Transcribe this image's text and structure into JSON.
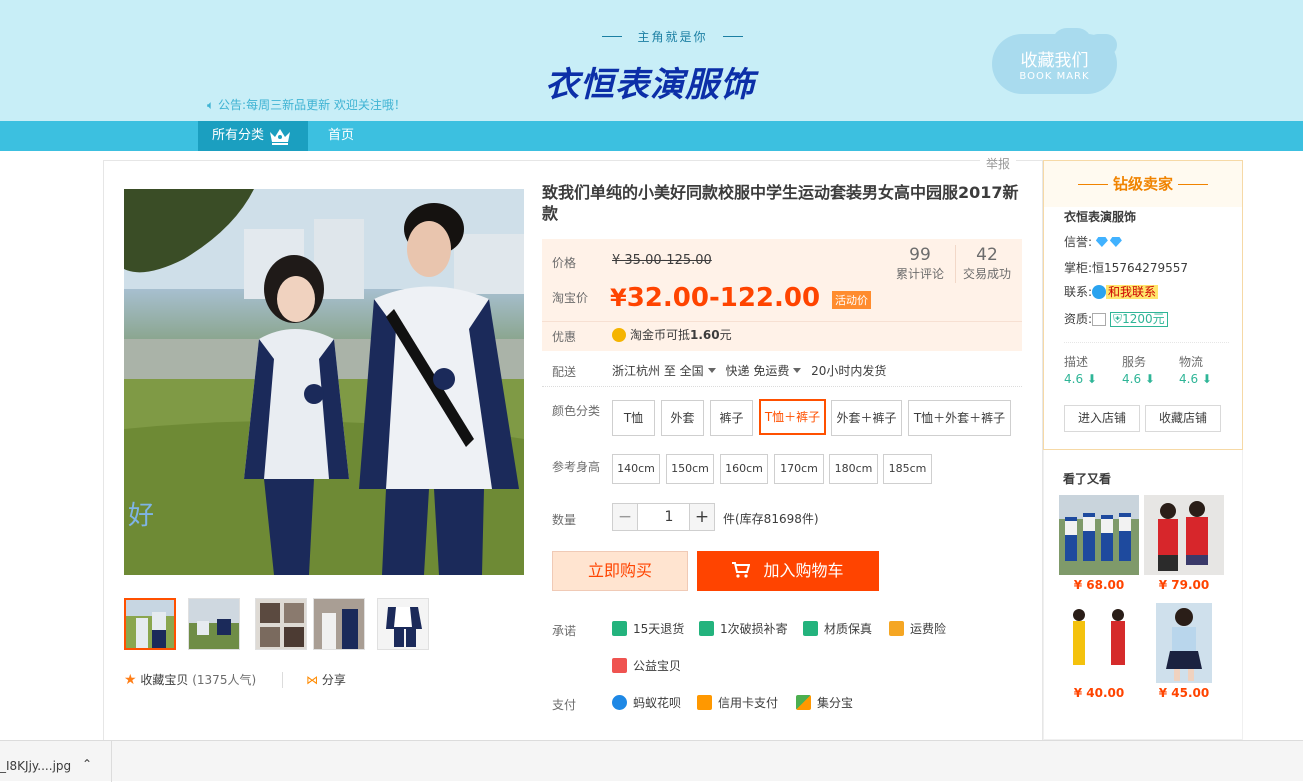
{
  "banner": {
    "tagline": "主角就是你",
    "shop_name": "衣恒表演服饰",
    "notice": "公告:每周三新品更新 欢迎关注哦！",
    "bookmark_cn": "收藏我们",
    "bookmark_en": "BOOK MARK"
  },
  "nav": {
    "all_categories": "所有分类",
    "home": "首页"
  },
  "report": "举报",
  "product": {
    "title": "致我们单纯的小美好同款校服中学生运动套装男女高中园服2017新款",
    "price_label": "价格",
    "original_price": "¥ 35.00-125.00",
    "taobao_price_label": "淘宝价",
    "currency": "¥",
    "taobao_price": "32.00-122.00",
    "promo_badge": "活动价",
    "reviews_count": "99",
    "reviews_label": "累计评论",
    "sales_count": "42",
    "sales_label": "交易成功",
    "discount_label": "优惠",
    "discount_text_prefix": "淘金币可抵",
    "discount_amount": "1.60",
    "discount_text_suffix": "元",
    "shipping_label": "配送",
    "ship_from": "浙江杭州 至",
    "ship_to": "全国",
    "ship_method": "快递 免运费",
    "ship_time": "20小时内发货",
    "color_label": "颜色分类",
    "colors": [
      "T恤",
      "外套",
      "裤子",
      "T恤＋裤子",
      "外套＋裤子",
      "T恤＋外套＋裤子"
    ],
    "selected_color": "T恤＋裤子",
    "size_label": "参考身高",
    "sizes": [
      "140cm",
      "150cm",
      "160cm",
      "170cm",
      "180cm",
      "185cm"
    ],
    "qty_label": "数量",
    "qty_minus": "−",
    "qty_value": "1",
    "qty_plus": "+",
    "stock_text": "件(库存81698件)",
    "buy_now": "立即购买",
    "add_to_cart": "加入购物车",
    "promise_label": "承诺",
    "promises": [
      "15天退货",
      "1次破损补寄",
      "材质保真",
      "运费险",
      "公益宝贝"
    ],
    "pay_label": "支付",
    "payments": [
      "蚂蚁花呗",
      "信用卡支付",
      "集分宝"
    ],
    "favorite_text": "收藏宝贝",
    "favorite_count": "(1375人气)",
    "share_text": "分享"
  },
  "seller": {
    "header": "钻级卖家",
    "shop_name": "衣恒表演服饰",
    "credit_label": "信誉:",
    "keeper_label": "掌柜:",
    "keeper_name": "恒15764279557",
    "contact_label": "联系:",
    "contact_button": "和我联系",
    "qualification_label": "资质:",
    "deposit": "1200元",
    "scores": [
      {
        "label": "描述",
        "value": "4.6"
      },
      {
        "label": "服务",
        "value": "4.6"
      },
      {
        "label": "物流",
        "value": "4.6"
      }
    ],
    "enter_shop": "进入店铺",
    "favorite_shop": "收藏店铺"
  },
  "also_viewed": {
    "title": "看了又看",
    "items": [
      {
        "price": "¥ 68.00"
      },
      {
        "price": "¥ 79.00"
      },
      {
        "price": "¥ 40.00"
      },
      {
        "price": "¥ 45.00"
      }
    ]
  },
  "download_bar": {
    "filename": "_I8KJjy....jpg"
  }
}
